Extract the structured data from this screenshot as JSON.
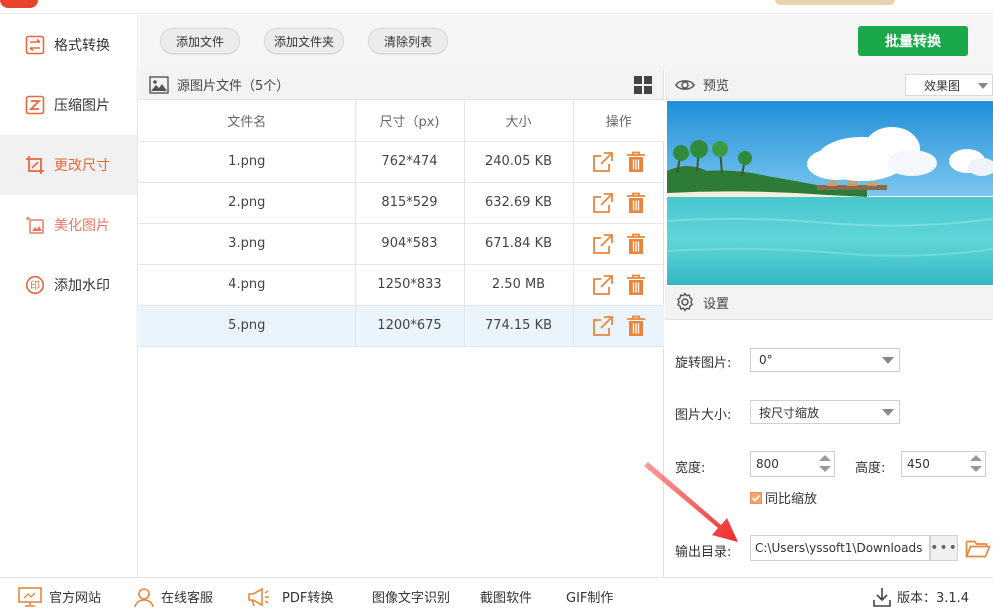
{
  "sidebar": {
    "items": [
      {
        "label": "格式转换",
        "icon": "format-convert-icon"
      },
      {
        "label": "压缩图片",
        "icon": "compress-icon"
      },
      {
        "label": "更改尺寸",
        "icon": "resize-icon"
      },
      {
        "label": "美化图片",
        "icon": "beautify-icon"
      },
      {
        "label": "添加水印",
        "icon": "watermark-icon"
      }
    ],
    "active_index": 2
  },
  "toolbar": {
    "add_file": "添加文件",
    "add_folder": "添加文件夹",
    "clear_list": "清除列表",
    "batch_convert": "批量转换"
  },
  "file_panel": {
    "title": "源图片文件（5个）",
    "columns": [
      "文件名",
      "尺寸（px)",
      "大小",
      "操作"
    ],
    "rows": [
      {
        "name": "1.png",
        "dims": "762*474",
        "size": "240.05 KB"
      },
      {
        "name": "2.png",
        "dims": "815*529",
        "size": "632.69 KB"
      },
      {
        "name": "3.png",
        "dims": "904*583",
        "size": "671.84 KB"
      },
      {
        "name": "4.png",
        "dims": "1250*833",
        "size": "2.50 MB"
      },
      {
        "name": "5.png",
        "dims": "1200*675",
        "size": "774.15 KB"
      }
    ],
    "selected_index": 4
  },
  "preview": {
    "title": "预览",
    "mode": "效果图"
  },
  "settings": {
    "title": "设置",
    "rotate_label": "旋转图片:",
    "rotate_value": "0°",
    "size_label": "图片大小:",
    "size_value": "按尺寸缩放",
    "width_label": "宽度:",
    "width_value": "800",
    "height_label": "高度:",
    "height_value": "450",
    "keep_ratio_label": "同比缩放",
    "output_label": "输出目录:",
    "output_path": "C:\\Users\\yssoft1\\Downloads",
    "browse_label": "•••"
  },
  "bottom": {
    "website": "官方网站",
    "support": "在线客服",
    "pdf": "PDF转换",
    "ocr": "图像文字识别",
    "screenshot": "截图软件",
    "gif": "GIF制作",
    "version": "版本：3.1.4"
  },
  "colors": {
    "accent": "#e8683b",
    "green": "#1aa84a",
    "annotation_arrow": "#ee3b3b"
  }
}
